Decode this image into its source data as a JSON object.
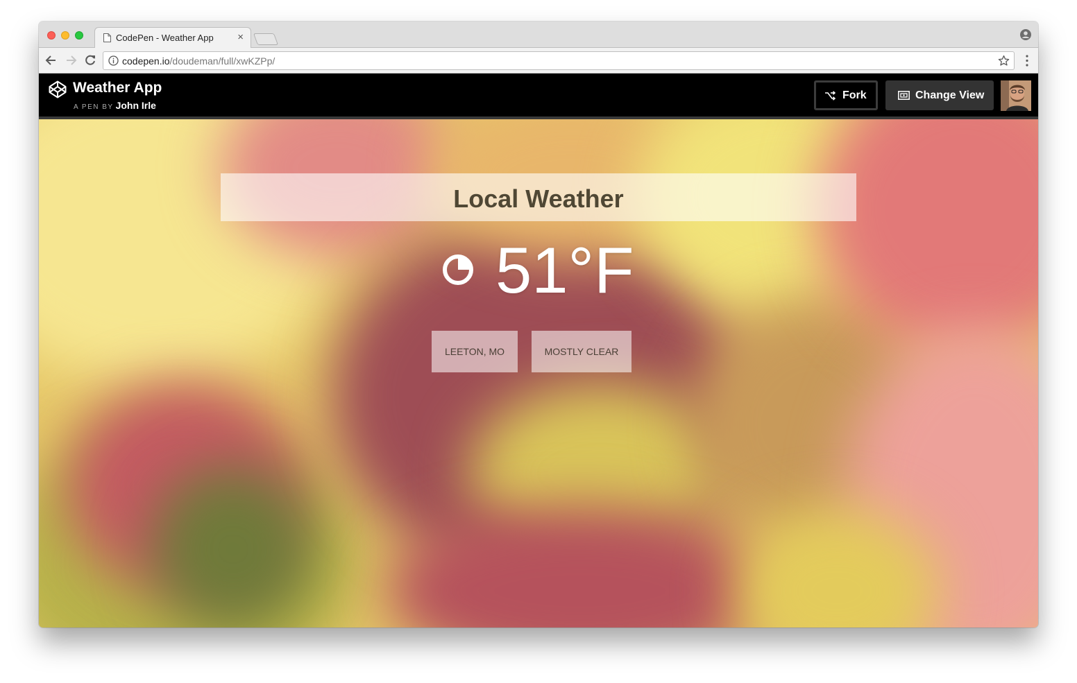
{
  "browser": {
    "tab_title": "CodePen - Weather App",
    "tab_close": "×",
    "url_host": "codepen.io",
    "url_path": "/doudeman/full/xwKZPp/"
  },
  "codepen": {
    "title": "Weather App",
    "pen_by": "A PEN BY",
    "author": "John Irle",
    "fork_label": "Fork",
    "change_view_label": "Change View"
  },
  "weather": {
    "heading": "Local Weather",
    "temperature": "51°F",
    "location": "LEETON, MO",
    "condition": "MOSTLY CLEAR",
    "icon": "moon-phase-icon"
  },
  "icons": {
    "tab": "document-icon",
    "back": "arrow-left-icon",
    "forward": "arrow-right-icon",
    "reload": "reload-icon",
    "info": "info-icon",
    "bookmark": "star-icon",
    "menu": "kebab-menu-icon",
    "profile": "profile-icon",
    "logo": "codepen-logo-icon",
    "fork": "fork-icon",
    "change_view": "change-view-icon"
  },
  "colors": {
    "header_bg": "#000000",
    "change_view_bg": "#333333",
    "heading_text": "#4f4734",
    "temperature_text": "#ffffff"
  }
}
